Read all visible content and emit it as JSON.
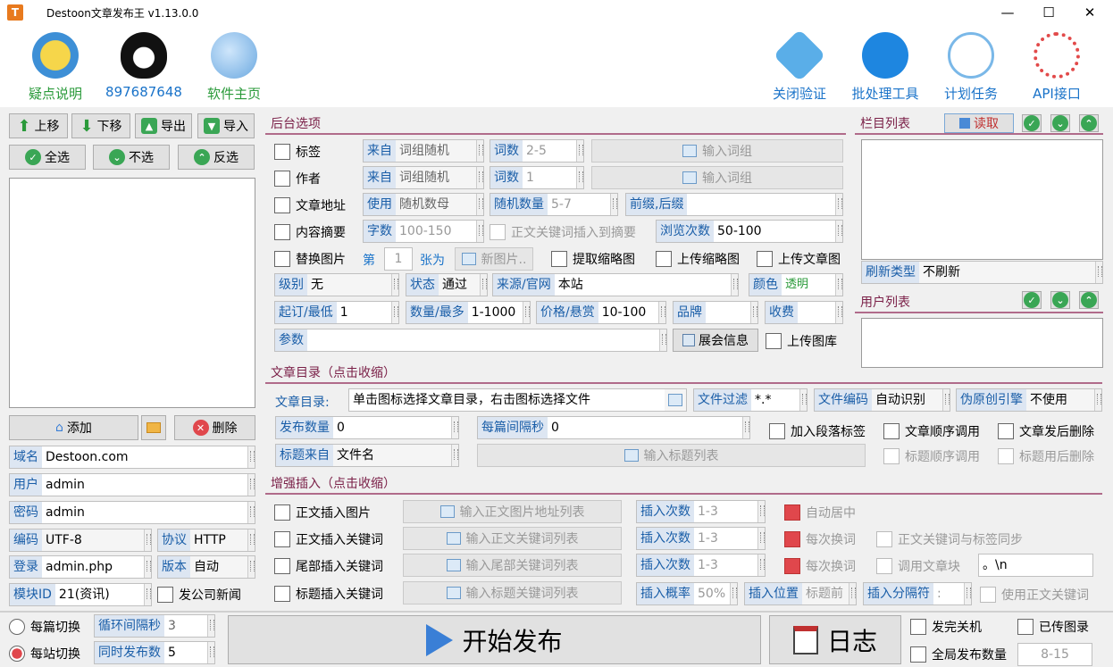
{
  "app": {
    "title": "Destoon文章发布王 v1.13.0.0",
    "icon": "T"
  },
  "window": {
    "min": "—",
    "max": "☐",
    "close": "✕"
  },
  "toolbar": {
    "help": "疑点说明",
    "qq": "897687648",
    "homepage": "软件主页",
    "close_verify": "关闭验证",
    "batch": "批处理工具",
    "schedule": "计划任务",
    "api": "API接口"
  },
  "left": {
    "up": "上移",
    "down": "下移",
    "export": "导出",
    "import": "导入",
    "select_all": "全选",
    "select_none": "不选",
    "invert": "反选",
    "add": "添加",
    "delete": "删除",
    "fields": {
      "domain_l": "域名",
      "domain": "Destoon.com",
      "user_l": "用户",
      "user": "admin",
      "pass_l": "密码",
      "pass": "admin",
      "enc_l": "编码",
      "enc": "UTF-8",
      "proto_l": "协议",
      "proto": "HTTP",
      "login_l": "登录",
      "login": "admin.php",
      "ver_l": "版本",
      "ver": "自动",
      "mod_l": "模块ID",
      "mod": "21(资讯)",
      "company_news": "发公司新闻"
    }
  },
  "backend": {
    "title": "后台选项",
    "tag": "标签",
    "author": "作者",
    "url": "文章地址",
    "summary": "内容摘要",
    "replace_img": "替换图片",
    "from_l": "来自",
    "from1": "词组随机",
    "from2": "词组随机",
    "words_l": "词数",
    "words1": "2-5",
    "words2": "1",
    "input_group": "输入词组",
    "use_l": "使用",
    "use": "随机数母",
    "randn_l": "随机数量",
    "randn": "5-7",
    "prefix_l": "前缀,后缀",
    "chars_l": "字数",
    "chars": "100-150",
    "kw_insert": "正文关键词插入到摘要",
    "views_l": "浏览次数",
    "views": "50-100",
    "di": "第",
    "di_val": "1",
    "zhang": "张为",
    "new_img": "新图片..",
    "extract_thumb": "提取缩略图",
    "upload_thumb": "上传缩略图",
    "upload_img": "上传文章图",
    "level_l": "级别",
    "level": "无",
    "status_l": "状态",
    "status": "通过",
    "source_l": "来源/官网",
    "source": "本站",
    "color_l": "颜色",
    "color": "透明",
    "start_l": "起订/最低",
    "start": "1",
    "qty_l": "数量/最多",
    "qty": "1-1000",
    "price_l": "价格/悬赏",
    "price": "10-100",
    "brand_l": "品牌",
    "fee_l": "收费",
    "param_l": "参数",
    "expo": "展会信息",
    "gallery": "上传图库"
  },
  "dir": {
    "title": "文章目录（点击收缩）",
    "dir_l": "文章目录:",
    "dir_hint": "单击图标选择文章目录，右击图标选择文件",
    "filter_l": "文件过滤",
    "filter": "*.*",
    "enc_l": "文件编码",
    "enc": "自动识别",
    "orig_l": "伪原创引擎",
    "orig": "不使用",
    "pubnum_l": "发布数量",
    "pubnum": "0",
    "interval_l": "每篇间隔秒",
    "interval": "0",
    "para_tag": "加入段落标签",
    "seq": "文章顺序调用",
    "del_after": "文章发后删除",
    "title_src_l": "标题来自",
    "title_src": "文件名",
    "input_titles": "输入标题列表",
    "title_seq": "标题顺序调用",
    "title_del": "标题用后删除"
  },
  "enh": {
    "title": "增强插入（点击收缩）",
    "r1": "正文插入图片",
    "r1b": "输入正文图片地址列表",
    "r2": "正文插入关键词",
    "r2b": "输入正文关键词列表",
    "r3": "尾部插入关键词",
    "r3b": "输入尾部关键词列表",
    "r4": "标题插入关键词",
    "r4b": "输入标题关键词列表",
    "times_l": "插入次数",
    "times": "1-3",
    "prob_l": "插入概率",
    "prob": "50%",
    "pos_l": "插入位置",
    "pos": "标题前",
    "sep_l": "插入分隔符",
    "sep": ":",
    "auto_center": "自动居中",
    "each1": "每次换词",
    "each2": "每次换词",
    "kw_sync": "正文关键词与标签同步",
    "call_block": "调用文章块",
    "block_val": "。\\n",
    "use_body_kw": "使用正文关键词"
  },
  "right": {
    "cat_title": "栏目列表",
    "read": "读取",
    "refresh_l": "刷新类型",
    "refresh": "不刷新",
    "user_title": "用户列表"
  },
  "bottom": {
    "per_article": "每篇切换",
    "per_site": "每站切换",
    "loop_l": "循环间隔秒",
    "loop": "3",
    "sync_l": "同时发布数",
    "sync": "5",
    "start": "开始发布",
    "log": "日志",
    "shutdown": "发完关机",
    "recorded": "已传图录",
    "global_l": "全局发布数量",
    "global": "8-15"
  }
}
